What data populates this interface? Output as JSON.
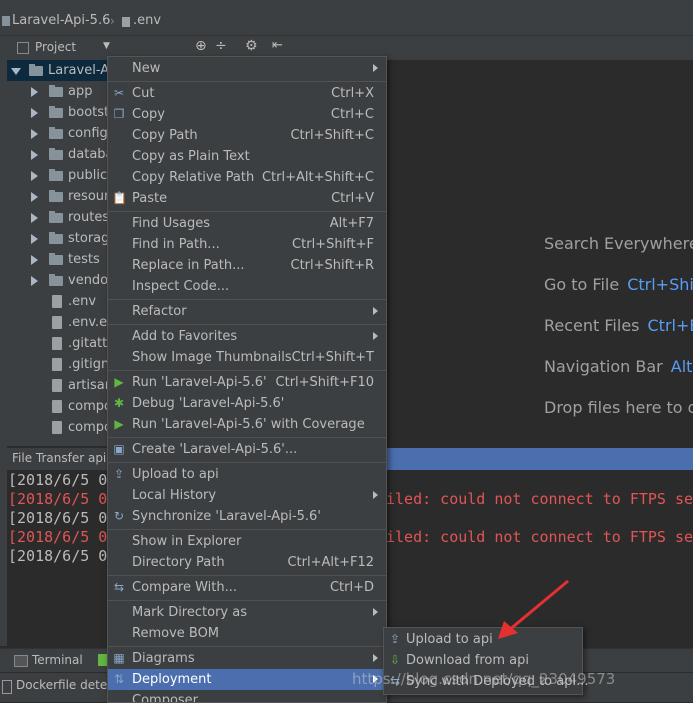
{
  "colors": {
    "accent": "#4b6eaf",
    "error": "#e05555",
    "link": "#589df6"
  },
  "breadcrumb": {
    "project": "Laravel-Api-5.6",
    "file": ".env"
  },
  "project_panel": {
    "title": "Project",
    "root": "Laravel-Ap",
    "items": [
      {
        "label": "app",
        "type": "folder"
      },
      {
        "label": "bootstr",
        "type": "folder"
      },
      {
        "label": "config",
        "type": "folder"
      },
      {
        "label": "databa",
        "type": "folder"
      },
      {
        "label": "public",
        "type": "folder"
      },
      {
        "label": "resourc",
        "type": "folder"
      },
      {
        "label": "routes",
        "type": "folder"
      },
      {
        "label": "storage",
        "type": "folder"
      },
      {
        "label": "tests",
        "type": "folder"
      },
      {
        "label": "vendor",
        "type": "folder"
      },
      {
        "label": ".env",
        "type": "file"
      },
      {
        "label": ".env.ex",
        "type": "file"
      },
      {
        "label": ".gitattri",
        "type": "file"
      },
      {
        "label": ".gitigno",
        "type": "file"
      },
      {
        "label": "artisan",
        "type": "file"
      },
      {
        "label": "compo",
        "type": "file"
      },
      {
        "label": "compo",
        "type": "file"
      }
    ]
  },
  "editor_hints": [
    {
      "text": "Search Everywhere",
      "key": ""
    },
    {
      "text": "Go to File",
      "key": "Ctrl+Shift"
    },
    {
      "text": "Recent Files",
      "key": "Ctrl+E"
    },
    {
      "text": "Navigation Bar",
      "key": "Alt+"
    },
    {
      "text": "Drop files here to op",
      "key": ""
    }
  ],
  "file_transfer": {
    "title": "File Transfer api",
    "lines": [
      {
        "prefix": "[2018/6/5 0",
        "error": false,
        "tail": ""
      },
      {
        "prefix": "[2018/6/5 0",
        "error": true,
        "tail": "iled: could not connect to FTPS ser"
      },
      {
        "prefix": "[2018/6/5 0",
        "error": false,
        "tail": ""
      },
      {
        "prefix": "[2018/6/5 0",
        "error": true,
        "tail": "iled: could not connect to FTPS ser"
      },
      {
        "prefix": "[2018/6/5 0",
        "error": false,
        "tail": ""
      }
    ]
  },
  "bottom_tabs": {
    "terminal": "Terminal"
  },
  "status": {
    "text": "Dockerfile detec"
  },
  "context_menu": {
    "items": [
      {
        "label": "New",
        "shortcut": "",
        "submenu": true,
        "icon": ""
      },
      {
        "sep": true
      },
      {
        "label": "Cut",
        "shortcut": "Ctrl+X",
        "icon": "✂"
      },
      {
        "label": "Copy",
        "shortcut": "Ctrl+C",
        "icon": "❐"
      },
      {
        "label": "Copy Path",
        "shortcut": "Ctrl+Shift+C",
        "icon": ""
      },
      {
        "label": "Copy as Plain Text",
        "shortcut": "",
        "icon": ""
      },
      {
        "label": "Copy Relative Path",
        "shortcut": "Ctrl+Alt+Shift+C",
        "icon": ""
      },
      {
        "label": "Paste",
        "shortcut": "Ctrl+V",
        "icon": "📋"
      },
      {
        "sep": true
      },
      {
        "label": "Find Usages",
        "shortcut": "Alt+F7",
        "icon": ""
      },
      {
        "label": "Find in Path...",
        "shortcut": "Ctrl+Shift+F",
        "icon": ""
      },
      {
        "label": "Replace in Path...",
        "shortcut": "Ctrl+Shift+R",
        "icon": ""
      },
      {
        "label": "Inspect Code...",
        "shortcut": "",
        "icon": ""
      },
      {
        "sep": true
      },
      {
        "label": "Refactor",
        "shortcut": "",
        "submenu": true,
        "icon": ""
      },
      {
        "sep": true
      },
      {
        "label": "Add to Favorites",
        "shortcut": "",
        "submenu": true,
        "icon": ""
      },
      {
        "label": "Show Image Thumbnails",
        "shortcut": "Ctrl+Shift+T",
        "icon": ""
      },
      {
        "sep": true
      },
      {
        "label": "Run 'Laravel-Api-5.6'",
        "shortcut": "Ctrl+Shift+F10",
        "icon": "▶"
      },
      {
        "label": "Debug 'Laravel-Api-5.6'",
        "shortcut": "",
        "icon": "✱"
      },
      {
        "label": "Run 'Laravel-Api-5.6' with Coverage",
        "shortcut": "",
        "icon": "▶"
      },
      {
        "sep": true
      },
      {
        "label": "Create 'Laravel-Api-5.6'...",
        "shortcut": "",
        "icon": "▣"
      },
      {
        "sep": true
      },
      {
        "label": "Upload to api",
        "shortcut": "",
        "icon": "⇪"
      },
      {
        "label": "Local History",
        "shortcut": "",
        "submenu": true,
        "icon": ""
      },
      {
        "label": "Synchronize 'Laravel-Api-5.6'",
        "shortcut": "",
        "icon": "↻"
      },
      {
        "sep": true
      },
      {
        "label": "Show in Explorer",
        "shortcut": "",
        "icon": ""
      },
      {
        "label": "Directory Path",
        "shortcut": "Ctrl+Alt+F12",
        "icon": ""
      },
      {
        "sep": true
      },
      {
        "label": "Compare With...",
        "shortcut": "Ctrl+D",
        "icon": "⇆"
      },
      {
        "sep": true
      },
      {
        "label": "Mark Directory as",
        "shortcut": "",
        "submenu": true,
        "icon": ""
      },
      {
        "label": "Remove BOM",
        "shortcut": "",
        "icon": ""
      },
      {
        "sep": true
      },
      {
        "label": "Diagrams",
        "shortcut": "",
        "submenu": true,
        "icon": "▦"
      },
      {
        "label": "Deployment",
        "shortcut": "",
        "submenu": true,
        "icon": "⇅",
        "highlight": true
      },
      {
        "label": "Composer",
        "shortcut": "",
        "icon": ""
      }
    ]
  },
  "deployment_submenu": {
    "items": [
      {
        "label": "Upload to api",
        "icon": "⇪"
      },
      {
        "label": "Download from api",
        "icon": "⇩"
      },
      {
        "label": "Sync with Deployed to api...",
        "icon": "⇆"
      }
    ]
  },
  "watermark": "https://blog.csdn.net/qq_23049573"
}
